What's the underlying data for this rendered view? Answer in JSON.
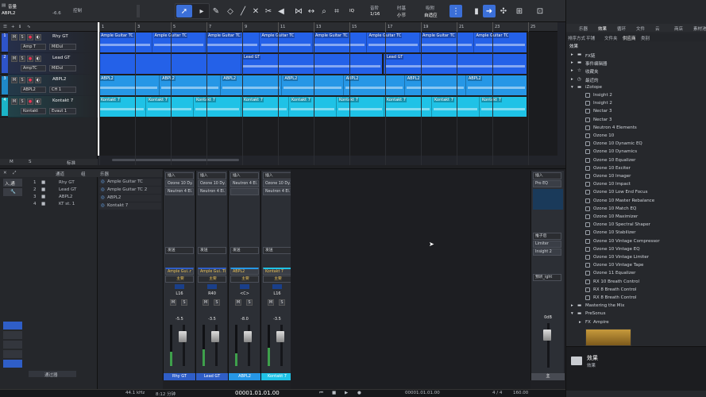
{
  "toolbar": {
    "song_label": "音量",
    "track_label": "ABPL2",
    "track_value": "-6.6",
    "control_label": "控制",
    "quantize_label": "IQ",
    "quantize_mode": "音阶",
    "quantize_value": "1/16",
    "timebase_label": "时基",
    "timebase_value": "小节",
    "snap_label": "吸附",
    "snap_value": "自适应"
  },
  "tracks": [
    {
      "num": "1",
      "name": "Rhy GT",
      "sub1": "Amp T",
      "sub2": "MIDul",
      "color": "#2e54c9"
    },
    {
      "num": "2",
      "name": "Lead GT",
      "sub1": "AmpTC",
      "sub2": "MIDul",
      "color": "#2e54c9"
    },
    {
      "num": "3",
      "name": "ABPL2",
      "sub1": "ABPL2",
      "sub2": "CH 1",
      "color": "#1f89c8"
    },
    {
      "num": "4",
      "name": "Kontakt 7",
      "sub1": "Kontakt",
      "sub2": "Evaut 1",
      "color": "#1bb4c7"
    }
  ],
  "track_header_footer": {
    "m": "M",
    "s": "S",
    "label": "标准"
  },
  "ruler": [
    "1",
    "3",
    "5",
    "7",
    "9",
    "11",
    "13",
    "15",
    "17",
    "19",
    "21",
    "23",
    "25"
  ],
  "lanes": [
    {
      "color": "#2461e8",
      "clips": [
        {
          "label": "Ample Guitar TC"
        },
        {
          "label": "Ample Guitar TC"
        },
        {
          "label": "Ample Guitar TC"
        },
        {
          "label": "Ample Guitar TC"
        },
        {
          "label": "Ample Guitar TC"
        },
        {
          "label": "Ample Guitar TC"
        },
        {
          "label": "Ample Guitar TC"
        },
        {
          "label": "Ample Guitar TC"
        }
      ]
    },
    {
      "color": "#2461e8",
      "clips": [
        {
          "label": "Lead GT"
        },
        {
          "label": "Lead GT"
        }
      ]
    },
    {
      "color": "#2697e6",
      "clips": [
        {
          "label": "ABPL2"
        },
        {
          "label": "ABPL2"
        },
        {
          "label": "ABPL2"
        },
        {
          "label": "ABPL2"
        },
        {
          "label": "ABPL2"
        },
        {
          "label": "ABPL2"
        },
        {
          "label": "ABPL2"
        }
      ]
    },
    {
      "color": "#1fc2e6",
      "clips": [
        {
          "label": "Kontakt 7"
        },
        {
          "label": "Kontakt 7"
        },
        {
          "label": "Kontakt 7"
        },
        {
          "label": "Kontakt 7"
        },
        {
          "label": "Kontakt 7"
        },
        {
          "label": "Kontakt 7"
        },
        {
          "label": "Kontakt 7"
        },
        {
          "label": "Kontakt 7"
        },
        {
          "label": "Kontakt 7"
        }
      ]
    }
  ],
  "browser": {
    "tabs": [
      "乐器",
      "效果",
      "循环",
      "文件",
      "云",
      "商店",
      "素材池"
    ],
    "subtabs": [
      "排序方式",
      "平铺",
      "文件夹",
      "供应商",
      "类别"
    ],
    "section": "效果",
    "items": [
      {
        "label": "FX链",
        "indent": 1,
        "type": "folder"
      },
      {
        "label": "事件编辑器",
        "indent": 1,
        "type": "folder"
      },
      {
        "label": "收藏夹",
        "indent": 1,
        "type": "star"
      },
      {
        "label": "最近的",
        "indent": 1,
        "type": "clock"
      },
      {
        "label": "iZotope",
        "indent": 1,
        "type": "folder-open"
      },
      {
        "label": "Insight 2",
        "indent": 2,
        "type": "plug"
      },
      {
        "label": "Insight 2",
        "indent": 2,
        "type": "plug"
      },
      {
        "label": "Nectar 3",
        "indent": 2,
        "type": "plug"
      },
      {
        "label": "Nectar 3",
        "indent": 2,
        "type": "plug"
      },
      {
        "label": "Neutron 4 Elements",
        "indent": 2,
        "type": "plug"
      },
      {
        "label": "Ozone 10",
        "indent": 2,
        "type": "plug"
      },
      {
        "label": "Ozone 10 Dynamic EQ",
        "indent": 2,
        "type": "plug"
      },
      {
        "label": "Ozone 10 Dynamics",
        "indent": 2,
        "type": "plug"
      },
      {
        "label": "Ozone 10 Equalizer",
        "indent": 2,
        "type": "plug"
      },
      {
        "label": "Ozone 10 Exciter",
        "indent": 2,
        "type": "plug"
      },
      {
        "label": "Ozone 10 Imager",
        "indent": 2,
        "type": "plug"
      },
      {
        "label": "Ozone 10 Impact",
        "indent": 2,
        "type": "plug"
      },
      {
        "label": "Ozone 10 Low End Focus",
        "indent": 2,
        "type": "plug"
      },
      {
        "label": "Ozone 10 Master Rebalance",
        "indent": 2,
        "type": "plug"
      },
      {
        "label": "Ozone 10 Match EQ",
        "indent": 2,
        "type": "plug"
      },
      {
        "label": "Ozone 10 Maximizer",
        "indent": 2,
        "type": "plug"
      },
      {
        "label": "Ozone 10 Spectral Shaper",
        "indent": 2,
        "type": "plug"
      },
      {
        "label": "Ozone 10 Stabilizer",
        "indent": 2,
        "type": "plug"
      },
      {
        "label": "Ozone 10 Vintage Compressor",
        "indent": 2,
        "type": "plug"
      },
      {
        "label": "Ozone 10 Vintage EQ",
        "indent": 2,
        "type": "plug"
      },
      {
        "label": "Ozone 10 Vintage Limiter",
        "indent": 2,
        "type": "plug"
      },
      {
        "label": "Ozone 10 Vintage Tape",
        "indent": 2,
        "type": "plug"
      },
      {
        "label": "Ozone 11 Equalizer",
        "indent": 2,
        "type": "plug"
      },
      {
        "label": "RX 10 Breath Control",
        "indent": 2,
        "type": "plug"
      },
      {
        "label": "RX 8 Breath Control",
        "indent": 2,
        "type": "plug"
      },
      {
        "label": "RX 8 Breath Control",
        "indent": 2,
        "type": "plug"
      },
      {
        "label": "Mastering the Mix",
        "indent": 1,
        "type": "folder"
      },
      {
        "label": "PreSonus",
        "indent": 1,
        "type": "folder-open"
      },
      {
        "label": "Ampire",
        "indent": 2,
        "type": "fx"
      }
    ],
    "footer_title": "效果",
    "footer_sub": "效果"
  },
  "mixer": {
    "list_header_left": "通道",
    "list_header_right": "组",
    "channels_list": [
      {
        "num": "1",
        "name": "Rhy GT"
      },
      {
        "num": "2",
        "name": "Lead GT"
      },
      {
        "num": "3",
        "name": "ABPL2"
      },
      {
        "num": "4",
        "name": "KT st. 1"
      }
    ],
    "instruments_header": "乐器",
    "instruments": [
      "Ample Guitar TC",
      "Ample Guitar TC 2",
      "ABPL2",
      "Kontakt 7"
    ],
    "list_footer": "通过器",
    "left_labels": {
      "input": "输入",
      "all": "入,通"
    },
    "channels": [
      {
        "insert": "插入",
        "slot1": "Ozone 10 Dy.",
        "slot2": "Neutron 4 El.",
        "send": "发送",
        "inst": "Ample Gui..r TC",
        "route": "主要",
        "pan": "L16",
        "vol": "-5.5",
        "name": "Rhy GT",
        "level": 0.35
      },
      {
        "insert": "插入",
        "slot1": "Ozone 10 Dy.",
        "slot2": "Neutron 4 El.",
        "send": "发送",
        "inst": "Ample Gui..TC 2",
        "route": "主要",
        "pan": "R40",
        "vol": "-3.5",
        "name": "Lead GT",
        "level": 0.4
      },
      {
        "insert": "插入",
        "slot1": "Neutron 4 El.",
        "slot2": "",
        "send": "发送",
        "inst": "ABPL2",
        "route": "主要",
        "pan": "<C>",
        "vol": "-8.0",
        "name": "ABPL2",
        "level": 0.3
      },
      {
        "insert": "插入",
        "slot1": "Ozone 10 Dy.",
        "slot2": "Neutron 4 El.",
        "send": "发送",
        "inst": "Kontakt 7",
        "route": "主要",
        "pan": "L16",
        "vol": "-3.5",
        "name": "Kontakt 7",
        "level": 0.45
      }
    ],
    "main": {
      "insert": "插入",
      "slot1": "Pro EQ",
      "post": "推子后",
      "slot2": "Limiter",
      "slot3": "Insight 2",
      "route": "预听_ight",
      "vol": "0dB",
      "name": "主"
    }
  },
  "transport": {
    "sample_rate": "44.1 kHz",
    "time_left": "8:12 分钟",
    "position": "00001.01.01.00",
    "position_right": "00001.01.01.00",
    "signature": "4 / 4",
    "tempo": "160.00"
  }
}
